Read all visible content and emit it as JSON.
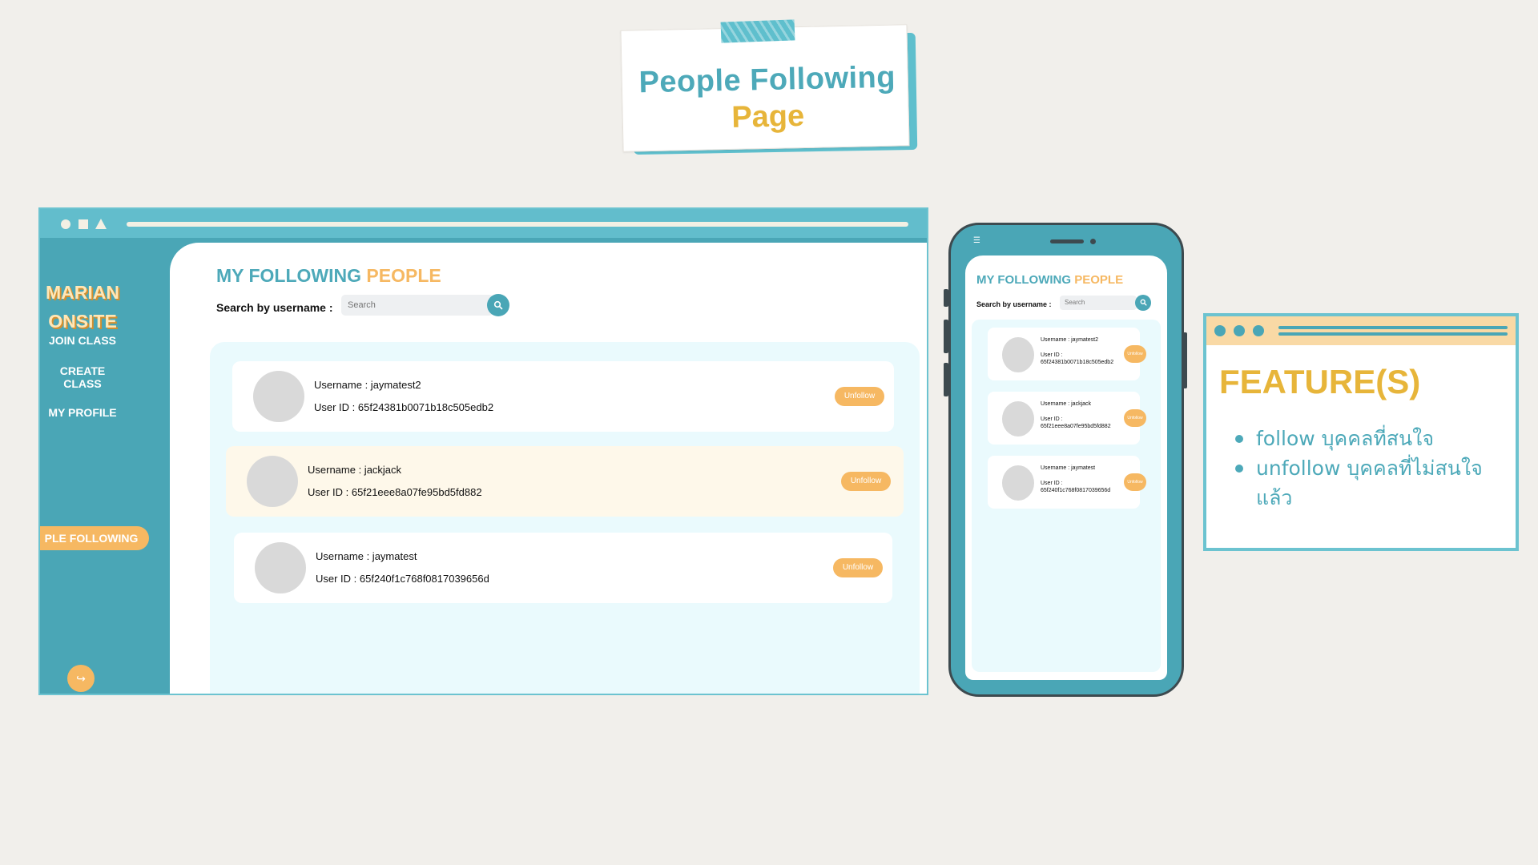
{
  "slide_title": {
    "line1": "People  Following",
    "line2": "Page"
  },
  "desktop": {
    "sidebar": {
      "brand_line1": "MARIAN",
      "brand_line2": "ONSITE",
      "items": [
        {
          "label": "JOIN CLASS"
        },
        {
          "label": "CREATE CLASS"
        },
        {
          "label": "MY PROFILE"
        },
        {
          "label": "PLE FOLLOWING"
        }
      ],
      "logout_icon": "logout-icon"
    },
    "main": {
      "heading_part1": "MY FOLLOWING ",
      "heading_part2": "PEOPLE",
      "search_label": "Search by username :",
      "search_placeholder": "Search",
      "search_icon": "search-icon",
      "users": [
        {
          "username": "Username : jaymatest2",
          "user_id": "User ID : 65f24381b0071b18c505edb2",
          "button": "Unfollow"
        },
        {
          "username": "Username : jackjack",
          "user_id": "User ID : 65f21eee8a07fe95bd5fd882",
          "button": "Unfollow"
        },
        {
          "username": "Username : jaymatest",
          "user_id": "User ID : 65f240f1c768f0817039656d",
          "button": "Unfollow"
        }
      ]
    }
  },
  "mobile": {
    "menu_icon": "hamburger-icon",
    "heading_part1": "MY FOLLOWING ",
    "heading_part2": "PEOPLE",
    "search_label": "Search by username :",
    "search_placeholder": "Search",
    "users": [
      {
        "username": "Username : jaymatest2",
        "id_label": "User ID :",
        "id_value": "65f24381b0071b18c505edb2",
        "button": "Unfollow"
      },
      {
        "username": "Username : jackjack",
        "id_label": "User ID :",
        "id_value": "65f21eee8a07fe95bd5fd882",
        "button": "Unfollow"
      },
      {
        "username": "Username : jaymatest",
        "id_label": "User ID :",
        "id_value": "65f240f1c768f0817039656d",
        "button": "Unfollow"
      }
    ]
  },
  "features": {
    "title": "FEATURE(S)",
    "items": [
      {
        "text": "follow บุคคลที่สนใจ"
      },
      {
        "text": "unfollow บุคคลที่ไม่สนใจแล้ว"
      }
    ]
  },
  "colors": {
    "teal": "#4aa6b6",
    "orange": "#f6b862",
    "yellow": "#e7b53a",
    "background": "#f1efeb"
  }
}
